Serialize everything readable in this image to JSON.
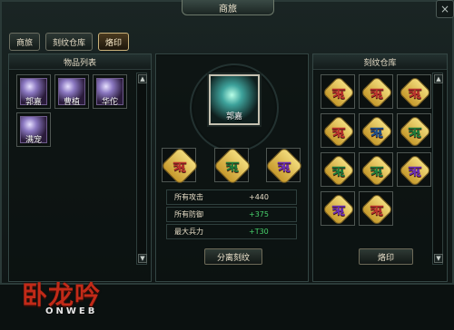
{
  "window": {
    "title": "商旅",
    "close_glyph": "×"
  },
  "tabs": [
    {
      "label": "商旅",
      "active": false
    },
    {
      "label": "刻纹仓库",
      "active": false
    },
    {
      "label": "烙印",
      "active": true
    }
  ],
  "left_panel": {
    "title": "物品列表",
    "items": [
      {
        "name": "郭嘉",
        "icon": "character-icon"
      },
      {
        "name": "曹植",
        "icon": "character-icon"
      },
      {
        "name": "华佗",
        "icon": "character-icon"
      },
      {
        "name": "满宠",
        "icon": "character-icon"
      }
    ],
    "scroll_up": "▲",
    "scroll_down": "▼"
  },
  "center_panel": {
    "portrait": {
      "name": "郭嘉",
      "icon": "character-portrait"
    },
    "amulets": [
      {
        "glyph": "ऋ",
        "icon": "rune-amulet-icon"
      },
      {
        "glyph": "ऋ",
        "icon": "rune-amulet-icon"
      },
      {
        "glyph": "ऋ",
        "icon": "rune-amulet-icon"
      }
    ],
    "stats": [
      {
        "label": "所有攻击",
        "value": "+440"
      },
      {
        "label": "所有防御",
        "value": "+375"
      },
      {
        "label": "最大兵力",
        "value": "+T30"
      }
    ],
    "separate_button": "分离刻纹"
  },
  "right_panel": {
    "title": "刻纹仓库",
    "inventory": [
      {
        "glyph": "ऋ"
      },
      {
        "glyph": "ऋ"
      },
      {
        "glyph": "ऋ"
      },
      {
        "glyph": "ऋ"
      },
      {
        "glyph": "ऋ"
      },
      {
        "glyph": "ऋ"
      },
      {
        "glyph": "ऋ"
      },
      {
        "glyph": "ऋ"
      },
      {
        "glyph": "ऋ"
      },
      {
        "glyph": "ऋ"
      },
      {
        "glyph": "ऋ"
      }
    ],
    "brand_button": "烙印",
    "scroll_up": "▲",
    "scroll_down": "▼"
  },
  "branding": {
    "logo_text": "卧龙吟",
    "logo_sub": "ONWEB"
  }
}
